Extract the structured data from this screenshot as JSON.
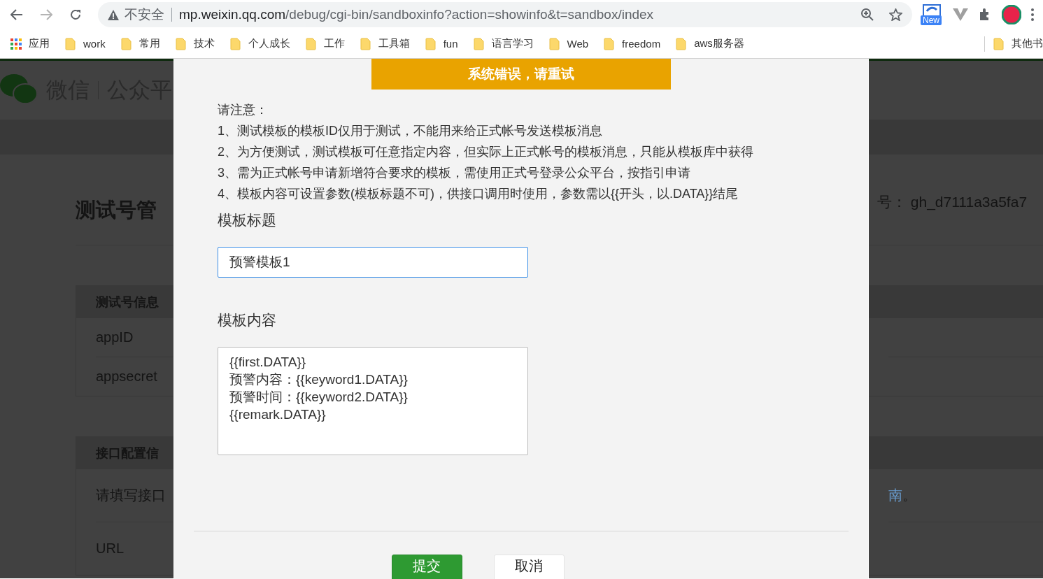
{
  "browser": {
    "nav": [
      {
        "kind": "back",
        "disabled": false
      },
      {
        "kind": "forward",
        "disabled": true
      },
      {
        "kind": "reload",
        "disabled": false
      }
    ],
    "security_label": "不安全",
    "url_host": "mp.weixin.qq.com",
    "url_path": "/debug/cgi-bin/sandboxinfo?action=showinfo&t=sandbox/index",
    "extension_badge": "New"
  },
  "bookmarks": [
    {
      "label": "应用",
      "kind": "apps"
    },
    {
      "label": "work",
      "kind": "folder"
    },
    {
      "label": "常用",
      "kind": "folder"
    },
    {
      "label": "技术",
      "kind": "folder"
    },
    {
      "label": "个人成长",
      "kind": "folder"
    },
    {
      "label": "工作",
      "kind": "folder"
    },
    {
      "label": "工具箱",
      "kind": "folder"
    },
    {
      "label": "fun",
      "kind": "folder"
    },
    {
      "label": "语言学习",
      "kind": "folder"
    },
    {
      "label": "Web",
      "kind": "folder"
    },
    {
      "label": "freedom",
      "kind": "folder"
    },
    {
      "label": "aws服务器",
      "kind": "folder"
    }
  ],
  "other_bookmarks": "其他书",
  "background": {
    "logo_text": "微信",
    "logo_sub": "公众平",
    "title": "测试号管",
    "account": "号： gh_d7111a3a5fa7",
    "panels": [
      {
        "header": "测试号信息",
        "rows": [
          "appID",
          "appsecret"
        ]
      },
      {
        "header": "接口配置信",
        "rows": [
          "请填写接口",
          "URL"
        ]
      }
    ],
    "link_tail": "南",
    "tail_text": "。"
  },
  "dialog": {
    "error": "系统错误，请重试",
    "notes": [
      "请注意：",
      "1、测试模板的模板ID仅用于测试，不能用来给正式帐号发送模板消息",
      "2、为方便测试，测试模板可任意指定内容，但实际上正式帐号的模板消息，只能从模板库中获得",
      "3、需为正式帐号申请新增符合要求的模板，需使用正式号登录公众平台，按指引申请",
      "4、模板内容可设置参数(模板标题不可)，供接口调用时使用，参数需以{{开头，以.DATA}}结尾"
    ],
    "fields": [
      {
        "label": "模板标题",
        "kind": "input",
        "value": "预警模板1"
      },
      {
        "label": "模板内容",
        "kind": "textarea",
        "value": "{{first.DATA}}\n预警内容：{{keyword1.DATA}}\n预警时间：{{keyword2.DATA}}\n{{remark.DATA}}"
      }
    ],
    "buttons": [
      {
        "label": "提交",
        "kind": "primary"
      },
      {
        "label": "取消",
        "kind": "default"
      }
    ]
  }
}
